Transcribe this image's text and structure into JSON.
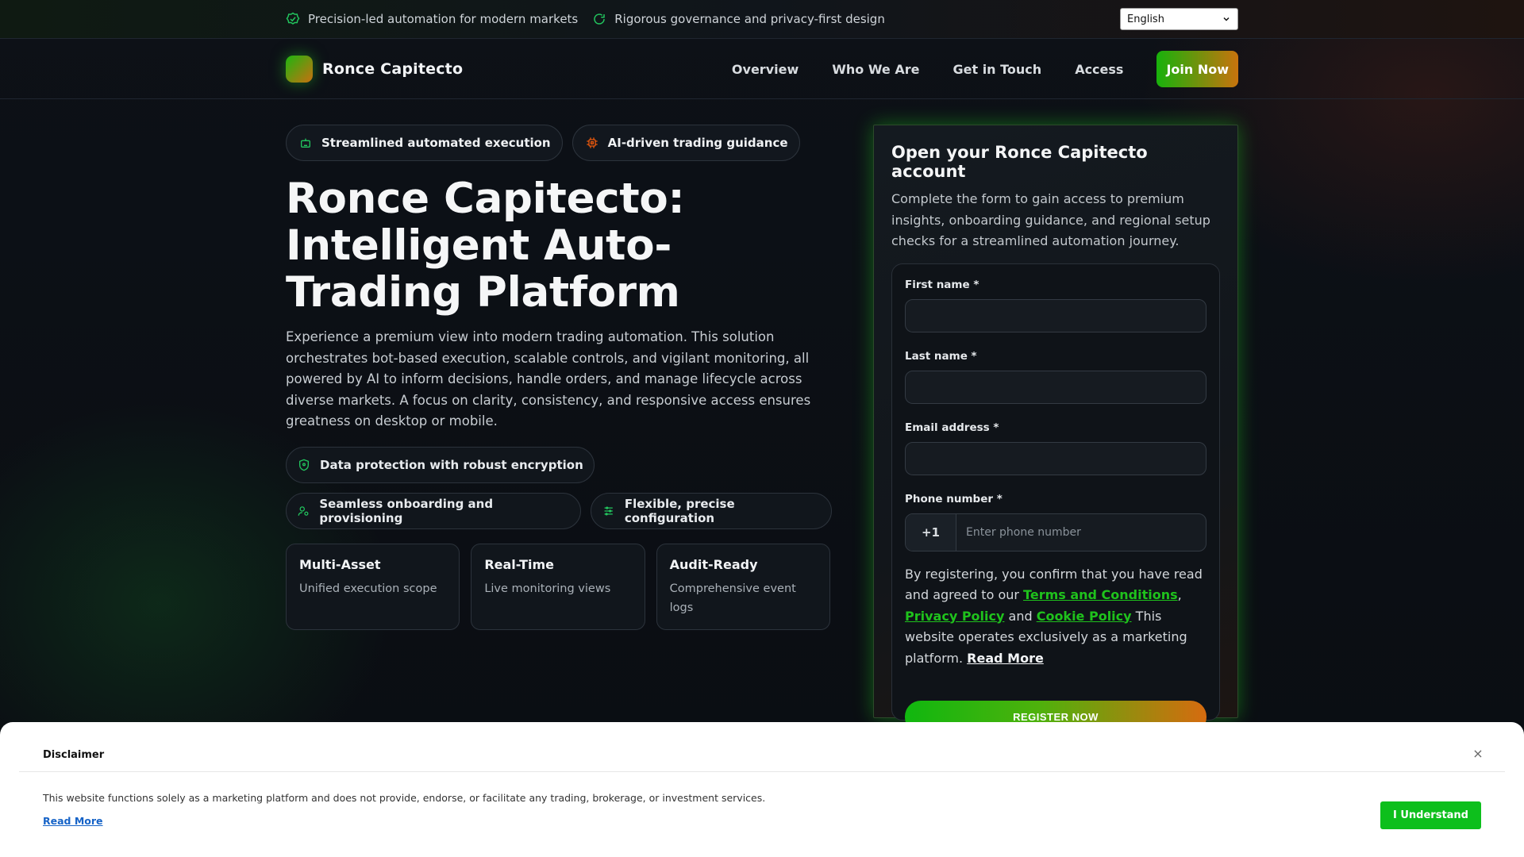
{
  "topbar": {
    "items": [
      {
        "icon": "shield-check-icon",
        "text": "Precision-led automation for modern markets"
      },
      {
        "icon": "refresh-icon",
        "text": "Rigorous governance and privacy-first design"
      }
    ],
    "language": "English"
  },
  "nav": {
    "brand": "Ronce Capitecto",
    "links": [
      "Overview",
      "Who We Are",
      "Get in Touch",
      "Access"
    ],
    "cta": "Join Now"
  },
  "hero": {
    "chips": [
      {
        "icon": "robot-icon",
        "text": "Streamlined automated execution",
        "color": "#22c55e"
      },
      {
        "icon": "cpu-icon",
        "text": "AI-driven trading guidance",
        "color": "#ea580c"
      }
    ],
    "title": "Ronce Capitecto: Intelligent Auto-Trading Platform",
    "description": "Experience a premium view into modern trading automation. This solution orchestrates bot-based execution, scalable controls, and vigilant monitoring, all powered by AI to inform decisions, handle orders, and manage lifecycle across diverse markets. A focus on clarity, consistency, and responsive access ensures greatness on desktop or mobile.",
    "features": [
      {
        "icon": "shield-icon",
        "text": "Data protection with robust encryption"
      },
      {
        "icon": "user-cog-icon",
        "text": "Seamless onboarding and provisioning"
      },
      {
        "icon": "sliders-icon",
        "text": "Flexible, precise configuration"
      }
    ],
    "cards": [
      {
        "title": "Multi-Asset",
        "subtitle": "Unified execution scope"
      },
      {
        "title": "Real-Time",
        "subtitle": "Live monitoring views"
      },
      {
        "title": "Audit-Ready",
        "subtitle": "Comprehensive event logs"
      }
    ]
  },
  "form": {
    "title": "Open your Ronce Capitecto account",
    "description": "Complete the form to gain access to premium insights, onboarding guidance, and regional setup checks for a streamlined automation journey.",
    "first_name_label": "First name *",
    "last_name_label": "Last name *",
    "email_label": "Email address *",
    "phone_label": "Phone number *",
    "phone_code": "+1",
    "phone_placeholder": "Enter phone number",
    "consent_pre": "By registering, you confirm that you have read and agreed to our ",
    "terms": "Terms and Conditions",
    "comma": ",",
    "privacy": "Privacy Policy",
    "and": " and ",
    "cookie": "Cookie Policy",
    "consent_post": " This website operates exclusively as a marketing platform. ",
    "read_more": "Read More",
    "submit": "REGISTER NOW"
  },
  "disclaimer": {
    "title": "Disclaimer",
    "close": "×",
    "text": "This website functions solely as a marketing platform and does not provide, endorse, or facilitate any trading, brokerage, or investment services.",
    "read_more": "Read More",
    "button": "I Understand"
  },
  "colors": {
    "accent_green": "#1fc21c",
    "accent_orange": "#d66b0f",
    "background": "#0b0e13"
  }
}
